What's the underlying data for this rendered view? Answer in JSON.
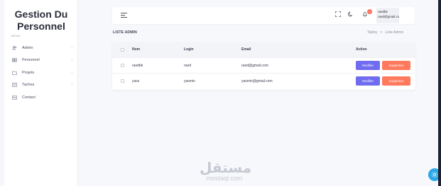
{
  "brand": {
    "line1": "Gestion Du",
    "line2": "Personnel"
  },
  "sidebar": {
    "section_label": "MENU",
    "items": [
      {
        "label": "Admin",
        "icon": "users-icon"
      },
      {
        "label": "Personnel",
        "icon": "team-icon"
      },
      {
        "label": "Projets",
        "icon": "folder-icon"
      },
      {
        "label": "Taches",
        "icon": "tasks-icon"
      },
      {
        "label": "Contact",
        "icon": "contact-card-icon"
      }
    ]
  },
  "topbar": {
    "notification_count": "3",
    "user_name": "raedbk",
    "user_email": "raed@gmail.com"
  },
  "page": {
    "title": "LISTE ADMIN",
    "breadcrumb": [
      "Tabloy",
      "Liste Admin"
    ]
  },
  "table": {
    "columns": [
      "Nom",
      "Login",
      "Email",
      "Action"
    ],
    "rows": [
      {
        "nom": "raedbk",
        "login": "raed",
        "email": "raed@gmail.com"
      },
      {
        "nom": "yass",
        "login": "yasmin",
        "email": "yasmin@gmail.com"
      }
    ],
    "edit_label": "Modifier",
    "delete_label": "Supprimer"
  },
  "watermark": {
    "logo": "مستقل",
    "text": "mostaql.com"
  },
  "colors": {
    "primary": "#6f6cf0",
    "danger": "#ff7a5c",
    "fab": "#2aa7e8"
  }
}
